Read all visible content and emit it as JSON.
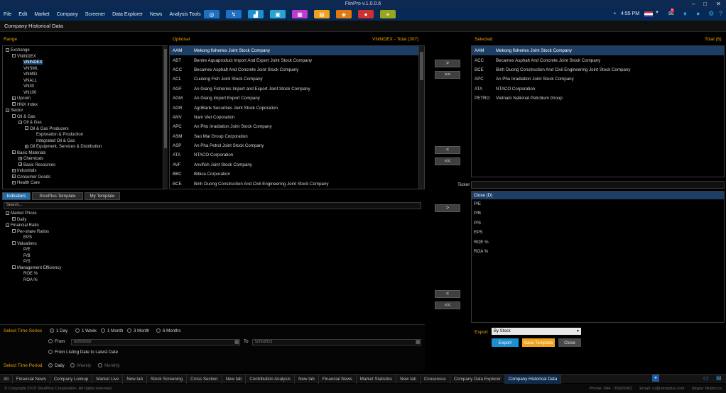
{
  "window": {
    "title": "FiinPro v.1.0.0.6"
  },
  "menu": [
    "File",
    "Edit",
    "Market",
    "Company",
    "Screener",
    "Data Explorer",
    "News",
    "Analysis Tools"
  ],
  "toolbar": {
    "colors": [
      "#1f6fc2",
      "#1f6fc2",
      "#1f8fcf",
      "#2aa3d0",
      "#c03ad0",
      "#f0a21a",
      "#e07a10",
      "#d03030",
      "#9aa51a"
    ]
  },
  "clock": {
    "time": "4:55 PM",
    "badge": "5"
  },
  "subtitle": "Company Historical Data",
  "range": {
    "header": "Range",
    "tree": [
      {
        "label": "Exchange",
        "level": 0,
        "pm": "-"
      },
      {
        "label": "VNINDEX",
        "level": 1,
        "pm": "-"
      },
      {
        "label": "VNINDEX",
        "level": 2,
        "pm": "",
        "selected": true
      },
      {
        "label": "VNSML",
        "level": 2,
        "pm": ""
      },
      {
        "label": "VNMID",
        "level": 2,
        "pm": ""
      },
      {
        "label": "VNALL",
        "level": 2,
        "pm": ""
      },
      {
        "label": "VN30",
        "level": 2,
        "pm": ""
      },
      {
        "label": "VN100",
        "level": 2,
        "pm": ""
      },
      {
        "label": "Upcom",
        "level": 1,
        "pm": "+"
      },
      {
        "label": "HNX Index",
        "level": 1,
        "pm": "+"
      },
      {
        "label": "Sector",
        "level": 0,
        "pm": "-"
      },
      {
        "label": "Oil & Gas",
        "level": 1,
        "pm": "-"
      },
      {
        "label": "Oil & Gas",
        "level": 2,
        "pm": "-"
      },
      {
        "label": "Oil & Gas Producers",
        "level": 3,
        "pm": "-"
      },
      {
        "label": "Exploration & Production",
        "level": 4,
        "pm": ""
      },
      {
        "label": "Integrated Oil & Gas",
        "level": 4,
        "pm": ""
      },
      {
        "label": "Oil Equipment, Services & Distribution",
        "level": 3,
        "pm": "+"
      },
      {
        "label": "Basic Materials",
        "level": 1,
        "pm": "+"
      },
      {
        "label": "Chemicals",
        "level": 2,
        "pm": "+"
      },
      {
        "label": "Basic Resources",
        "level": 2,
        "pm": "+"
      },
      {
        "label": "Industrials",
        "level": 1,
        "pm": "+"
      },
      {
        "label": "Consumer Goods",
        "level": 1,
        "pm": "+"
      },
      {
        "label": "Health Care",
        "level": 1,
        "pm": "+"
      }
    ]
  },
  "optional": {
    "header": "Optional",
    "total": "VNINDEX - Total (307)",
    "rows": [
      [
        "AAM",
        "Mekong fisheries Joint Stock Company"
      ],
      [
        "ABT",
        "Bentre Aquaproduct Import And Export Joint Stock Company"
      ],
      [
        "ACC",
        "Becamex Asphalt And Concrete Joint Stock Company"
      ],
      [
        "ACL",
        "Cuulong Fish Joint Stock Company"
      ],
      [
        "AGF",
        "An Giang Fisheries Import and Export Joint Stock Company"
      ],
      [
        "AGM",
        "An Giang Import Export Company"
      ],
      [
        "AGR",
        "AgriBank Securities Joint Stock Coporation"
      ],
      [
        "ANV",
        "Nam Viet Coporation"
      ],
      [
        "APC",
        "An Phu Irradiation Joint Stock Company"
      ],
      [
        "ASM",
        "Sao Mai Group Corporation"
      ],
      [
        "ASP",
        "An Pha Petrol Joint Stock Company"
      ],
      [
        "ATA",
        "NTACO Corporation"
      ],
      [
        "AVF",
        "Anvifish Joint Stock Company"
      ],
      [
        "BBC",
        "Bibica Corporation"
      ],
      [
        "BCE",
        "Binh Duong Construction And Civil Engineering Joint Stock Company"
      ]
    ]
  },
  "selected": {
    "header": "Selected",
    "total": "Total (6)",
    "rows": [
      [
        "AAM",
        "Mekong fisheries Joint Stock Company"
      ],
      [
        "ACC",
        "Becamex Asphalt And Concrete Joint Stock Company"
      ],
      [
        "BCE",
        "Binh Duong Construction And Civil Engineering Joint Stock Company"
      ],
      [
        "APC",
        "An Phu Irradiation Joint Stock Company"
      ],
      [
        "ATA",
        "NTACO Corporation"
      ],
      [
        "PETRO",
        "Vietnam National Petrolium Group"
      ]
    ]
  },
  "transfer": {
    "add": ">",
    "add_all": ">>",
    "remove": "<",
    "remove_all": "<<"
  },
  "ticker_label": "Ticker",
  "tabs": [
    "Indicators",
    "StoxPlus Template",
    "My Template"
  ],
  "search_placeholder": "Search...",
  "indicators_tree": [
    {
      "label": "Market Prices",
      "level": 0,
      "pm": "-"
    },
    {
      "label": "Daily",
      "level": 1,
      "pm": "+"
    },
    {
      "label": "Financial Ratio",
      "level": 0,
      "pm": "-"
    },
    {
      "label": "Per-share Ratios",
      "level": 1,
      "pm": "-"
    },
    {
      "label": "EPS",
      "level": 2,
      "pm": ""
    },
    {
      "label": "Valuations",
      "level": 1,
      "pm": "-"
    },
    {
      "label": "P/E",
      "level": 2,
      "pm": ""
    },
    {
      "label": "P/B",
      "level": 2,
      "pm": ""
    },
    {
      "label": "P/S",
      "level": 2,
      "pm": ""
    },
    {
      "label": "Management Efficiency",
      "level": 1,
      "pm": "-"
    },
    {
      "label": "ROE %",
      "level": 2,
      "pm": ""
    },
    {
      "label": "ROA %",
      "level": 2,
      "pm": ""
    }
  ],
  "close_header": "Close (D)",
  "selected_indicators": [
    "P/E",
    "P/B",
    "P/S",
    "EPS",
    "ROE %",
    "ROA %"
  ],
  "time_series": {
    "label": "Select Time Series",
    "options": [
      "1 Day",
      "1 Week",
      "1 Month",
      "3 Month",
      "6 Months"
    ],
    "from_label": "From",
    "from_value": "5/25/2015",
    "to_label": "To",
    "to_value": "5/25/2015",
    "listing_label": "From Listing Date to Latest Date"
  },
  "time_period": {
    "label": "Select Time Period",
    "options": [
      "Daily",
      "Weekly",
      "Monthly"
    ]
  },
  "export": {
    "label": "Export",
    "value": "By Stock",
    "export_btn": "Export",
    "save_btn": "Save Template",
    "close_btn": "Close"
  },
  "bottom_tabs": [
    "All",
    "Financial News",
    "Company Lookup",
    "Market Live",
    "New tab",
    "Stock Screening",
    "Cross Section",
    "New tab",
    "Contribution Analysis",
    "New tab",
    "Financial News",
    "Market Statistics",
    "New tab",
    "Consensus",
    "Company Data Explorer",
    "Company Historical Data"
  ],
  "status": {
    "copyright": "© Copyright 2015 StoxPlus Corporation. All rights reserved.",
    "phone": "Phone: 044 - 35626962",
    "email": "Email: cs@stoxplus.com",
    "skype": "Skype: fiinpro.cs"
  }
}
